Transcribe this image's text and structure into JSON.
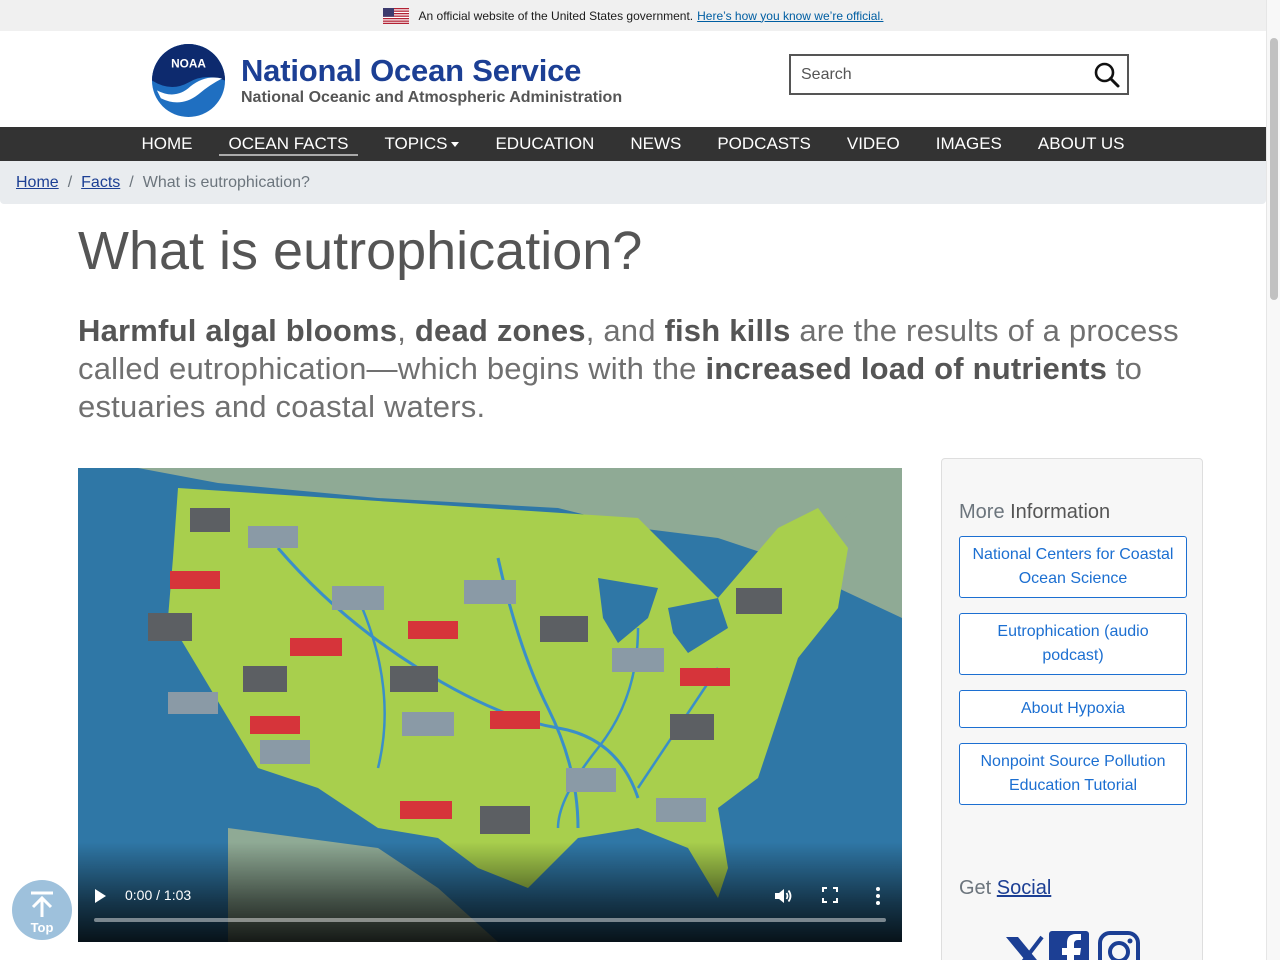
{
  "gov_banner": {
    "text": "An official website of the United States government.",
    "link": "Here’s how you know we’re official."
  },
  "header": {
    "logo_text": "NOAA",
    "title": "National Ocean Service",
    "subtitle": "National Oceanic and Atmospheric Administration",
    "search_placeholder": "Search"
  },
  "nav": {
    "items": [
      "HOME",
      "OCEAN FACTS",
      "TOPICS",
      "EDUCATION",
      "NEWS",
      "PODCASTS",
      "VIDEO",
      "IMAGES",
      "ABOUT US"
    ],
    "active": "OCEAN FACTS"
  },
  "breadcrumb": {
    "home": "Home",
    "facts": "Facts",
    "current": "What is eutrophication?"
  },
  "main": {
    "title": "What is eutrophication?",
    "lead": {
      "b1": "Harmful algal blooms",
      "t1": ", ",
      "b2": "dead zones",
      "t2": ", and ",
      "b3": "fish kills",
      "t3": " are the results of a process called eutrophication—which begins with the ",
      "b4": "increased load of nutrients",
      "t4": " to estuaries and coastal waters."
    }
  },
  "video": {
    "time": "0:00 / 1:03",
    "progress": 0
  },
  "sidebar": {
    "heading_pre": "More ",
    "heading_bold": "Information",
    "links": [
      "National Centers for Coastal Ocean Science",
      "Eutrophication (audio podcast)",
      "About Hypoxia",
      "Nonpoint Source Pollution Education Tutorial"
    ],
    "social_pre": "Get ",
    "social_bold": "Social"
  },
  "back_to_top": {
    "label": "Top"
  },
  "colors": {
    "brand": "#1c3f94",
    "nav_bg": "#333333",
    "link_blue": "#1c6fd1",
    "land": "#a8cf4d",
    "ocean": "#2f77a6"
  }
}
